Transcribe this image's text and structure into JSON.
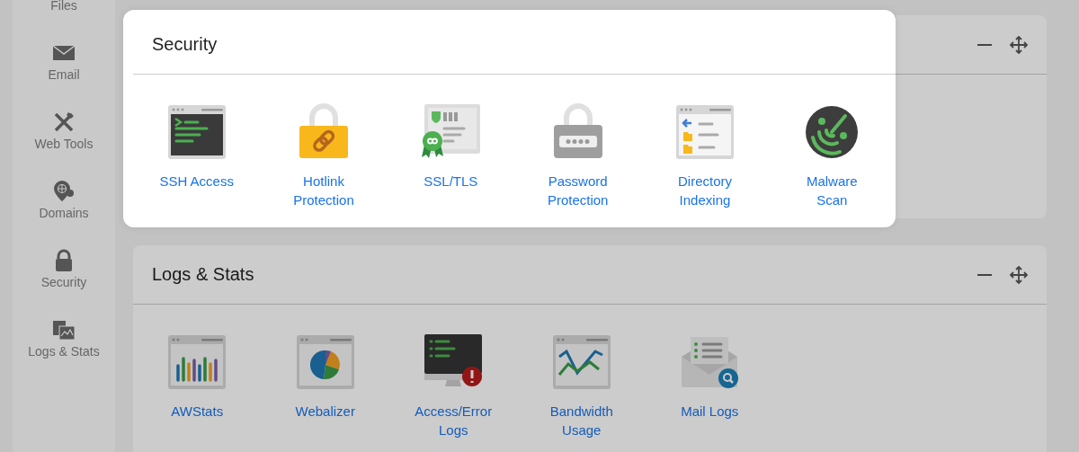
{
  "sidebar": {
    "items": [
      {
        "label": "Files"
      },
      {
        "label": "Email"
      },
      {
        "label": "Web Tools"
      },
      {
        "label": "Domains"
      },
      {
        "label": "Security"
      },
      {
        "label": "Logs & Stats"
      }
    ]
  },
  "panels": [
    {
      "title": "Security",
      "highlighted": true,
      "items": [
        {
          "label": "SSH Access"
        },
        {
          "label": "Hotlink\nProtection"
        },
        {
          "label": "SSL/TLS"
        },
        {
          "label": "Password\nProtection"
        },
        {
          "label": "Directory\nIndexing"
        },
        {
          "label": "Malware\nScan"
        }
      ]
    },
    {
      "title": "Logs & Stats",
      "highlighted": false,
      "items": [
        {
          "label": "AWStats"
        },
        {
          "label": "Webalizer"
        },
        {
          "label": "Access/Error\nLogs"
        },
        {
          "label": "Bandwidth\nUsage"
        },
        {
          "label": "Mail Logs"
        }
      ]
    }
  ]
}
